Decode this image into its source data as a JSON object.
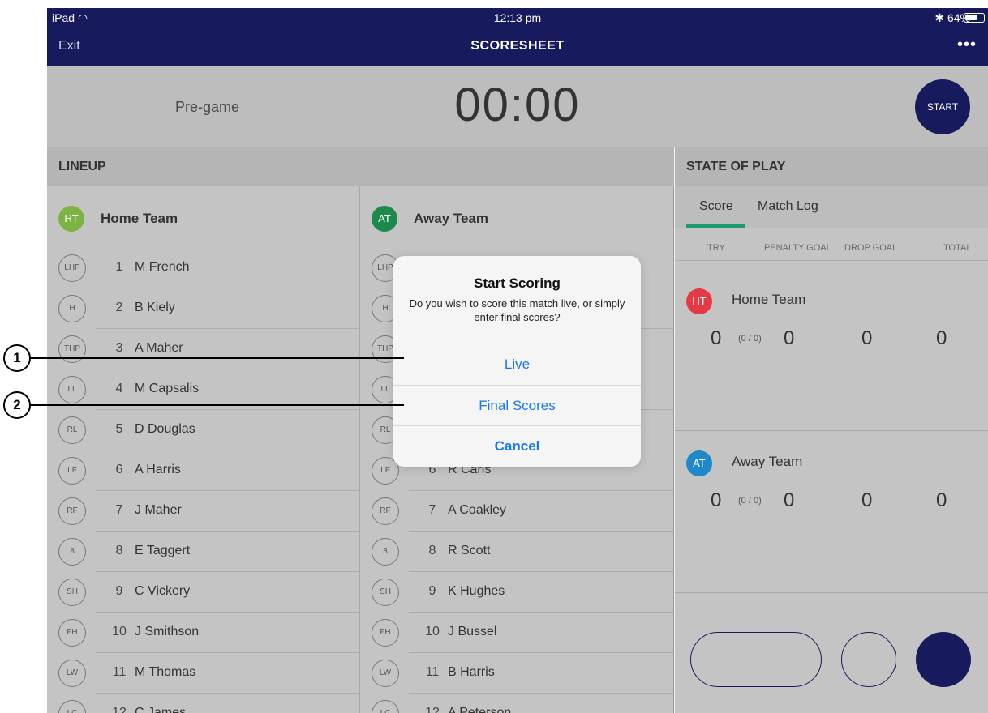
{
  "status_bar": {
    "device": "iPad",
    "time": "12:13 pm",
    "battery": "64%"
  },
  "nav": {
    "exit": "Exit",
    "title": "SCORESHEET",
    "more": "•••"
  },
  "timer": {
    "phase": "Pre-game",
    "clock": "00:00",
    "start": "START"
  },
  "lineup": {
    "header": "LINEUP",
    "home": {
      "badge": "HT",
      "name": "Home Team",
      "color": "#7cb342",
      "players": [
        {
          "pos": "LHP",
          "num": "1",
          "name": "M French"
        },
        {
          "pos": "H",
          "num": "2",
          "name": "B Kiely"
        },
        {
          "pos": "THP",
          "num": "3",
          "name": "A Maher"
        },
        {
          "pos": "LL",
          "num": "4",
          "name": "M Capsalis"
        },
        {
          "pos": "RL",
          "num": "5",
          "name": "D Douglas"
        },
        {
          "pos": "LF",
          "num": "6",
          "name": "A Harris"
        },
        {
          "pos": "RF",
          "num": "7",
          "name": "J Maher"
        },
        {
          "pos": "8",
          "num": "8",
          "name": "E Taggert"
        },
        {
          "pos": "SH",
          "num": "9",
          "name": "C Vickery"
        },
        {
          "pos": "FH",
          "num": "10",
          "name": "J Smithson"
        },
        {
          "pos": "LW",
          "num": "11",
          "name": "M Thomas"
        },
        {
          "pos": "LC",
          "num": "12",
          "name": "C James"
        }
      ]
    },
    "away": {
      "badge": "AT",
      "name": "Away Team",
      "color": "#1b8a4a",
      "players": [
        {
          "pos": "LHP",
          "num": "",
          "name": ""
        },
        {
          "pos": "H",
          "num": "",
          "name": ""
        },
        {
          "pos": "THP",
          "num": "",
          "name": ""
        },
        {
          "pos": "LL",
          "num": "",
          "name": ""
        },
        {
          "pos": "RL",
          "num": "",
          "name": ""
        },
        {
          "pos": "LF",
          "num": "6",
          "name": "R Caris"
        },
        {
          "pos": "RF",
          "num": "7",
          "name": "A Coakley"
        },
        {
          "pos": "8",
          "num": "8",
          "name": "R Scott"
        },
        {
          "pos": "SH",
          "num": "9",
          "name": "K Hughes"
        },
        {
          "pos": "FH",
          "num": "10",
          "name": "J Bussel"
        },
        {
          "pos": "LW",
          "num": "11",
          "name": "B Harris"
        },
        {
          "pos": "LC",
          "num": "12",
          "name": "A Peterson"
        }
      ]
    }
  },
  "state_of_play": {
    "header": "STATE OF PLAY",
    "tabs": {
      "score": "Score",
      "log": "Match Log"
    },
    "columns": {
      "try": "TRY",
      "penalty_goal": "PENALTY GOAL",
      "drop_goal": "DROP GOAL",
      "total": "TOTAL"
    },
    "home": {
      "badge": "HT",
      "name": "Home Team",
      "color": "#e53945",
      "try": "0",
      "penalty_detail": "(0 / 0)",
      "penalty_goal": "0",
      "drop_goal": "0",
      "total": "0"
    },
    "away": {
      "badge": "AT",
      "name": "Away Team",
      "color": "#1e88c9",
      "try": "0",
      "penalty_detail": "(0 / 0)",
      "penalty_goal": "0",
      "drop_goal": "0",
      "total": "0"
    }
  },
  "dialog": {
    "title": "Start Scoring",
    "message": "Do you wish to score this match live, or simply enter final scores?",
    "live": "Live",
    "final_scores": "Final Scores",
    "cancel": "Cancel"
  },
  "callouts": {
    "one": "1",
    "two": "2"
  },
  "colors": {
    "navy": "#181a5e",
    "accent_tab": "#1d9a73",
    "link_blue": "#1777f2"
  }
}
